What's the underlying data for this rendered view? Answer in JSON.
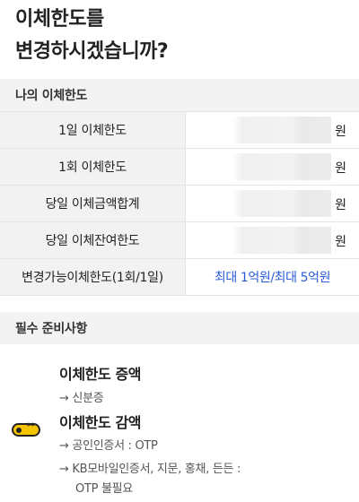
{
  "header": {
    "title_line1": "이체한도를",
    "title_line2": "변경하시겠습니까?"
  },
  "my_limits": {
    "section_title": "나의 이체한도",
    "rows": [
      {
        "label": "1일 이체한도",
        "unit": "원"
      },
      {
        "label": "1회 이체한도",
        "unit": "원"
      },
      {
        "label": "당일 이체금액합계",
        "unit": "원"
      },
      {
        "label": "당일 이체잔여한도",
        "unit": "원"
      }
    ],
    "changeable": {
      "label": "변경가능이체한도(1회/1일)",
      "value": "최대 1억원/최대 5억원"
    }
  },
  "requirements": {
    "section_title": "필수 준비사항",
    "increase": {
      "title": "이체한도 증액",
      "items": [
        "→ 신분증"
      ]
    },
    "decrease": {
      "title": "이체한도 감액",
      "items": [
        "→ 공인인증서 : OTP",
        "→ KB모바일인증서, 지문, 홍채, 든든 :",
        "OTP 불필요"
      ]
    },
    "icon": "otp-card-icon",
    "icon_text": "**",
    "icon_color": "#f5c400"
  }
}
